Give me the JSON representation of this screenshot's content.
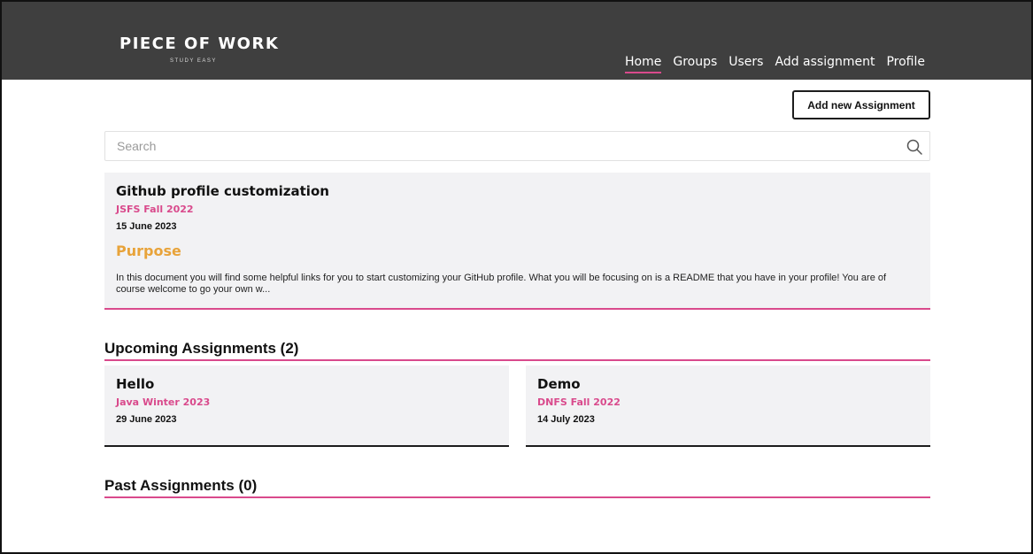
{
  "header": {
    "logo_title": "PIECE OF WORK",
    "logo_subtitle": "STUDY EASY",
    "nav": [
      "Home",
      "Groups",
      "Users",
      "Add assignment",
      "Profile"
    ],
    "active_nav": "Home"
  },
  "toolbar": {
    "add_label": "Add new Assignment"
  },
  "search": {
    "placeholder": "Search",
    "value": ""
  },
  "featured": {
    "title": "Github profile customization",
    "group": "JSFS Fall 2022",
    "date": "15 June 2023",
    "section_label": "Purpose",
    "description": "In this document you will find some helpful links for you to start customizing your GitHub profile. What you will be focusing on is a README that you have in your profile! You are of course welcome to go your own w..."
  },
  "upcoming": {
    "heading": "Upcoming Assignments (2)",
    "items": [
      {
        "title": "Hello",
        "group": "Java Winter 2023",
        "date": "29 June 2023"
      },
      {
        "title": "Demo",
        "group": "DNFS Fall 2022",
        "date": "14 July 2023"
      }
    ]
  },
  "past": {
    "heading": "Past Assignments (0)"
  },
  "colors": {
    "header_bg": "#3f3f3f",
    "accent": "#d94a8c",
    "purpose": "#e8a33a",
    "card_bg": "#f2f2f4"
  },
  "icons": {
    "search": "search-icon"
  }
}
